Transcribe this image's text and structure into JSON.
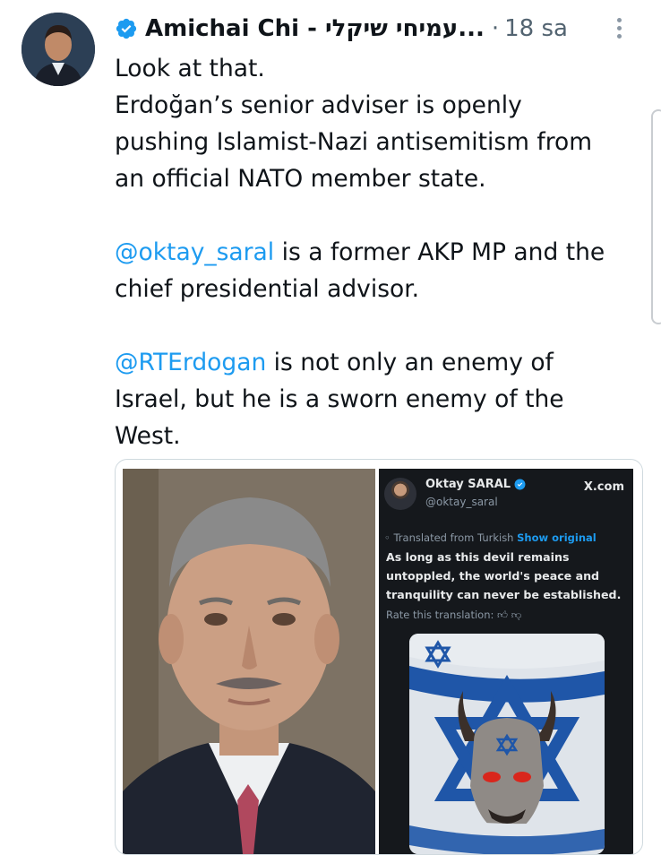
{
  "tweet": {
    "author_name": "Amichai Chi - עמיחי שיקלי...",
    "separator": "·",
    "timestamp": "18 sa",
    "verified_icon": "verified-badge-icon",
    "more_icon": "more-vertical-icon",
    "paragraphs": [
      [
        "Look at that."
      ],
      [
        "Erdoğan’s senior adviser is openly",
        "pushing Islamist-Nazi antisemitism from",
        "an official NATO member state."
      ]
    ],
    "mention1": "@oktay_saral",
    "para2_line1_rest": " is a former AKP MP and the",
    "para2_line2": "chief presidential advisor.",
    "mention2": "@RTErdogan",
    "para3_line1_rest": " is not only an enemy of",
    "para3_line2": "Israel, but he is a sworn enemy of the",
    "para3_line3": "West."
  },
  "embedded": {
    "name": "Oktay SARAL",
    "handle": "@oktay_saral",
    "brand": "X.com",
    "translated_label": "Translated from Turkish",
    "show_original": "Show original",
    "body_lines": [
      "As long as this devil remains",
      "untoppled, the world's peace and",
      "tranquility can never be established."
    ],
    "rate_label": "Rate this translation:",
    "rate_icons": [
      "thumbs-up-icon",
      "thumbs-down-icon"
    ]
  },
  "colors": {
    "link": "#1d9bf0",
    "verified": "#1d9bf0",
    "text": "#0f1419",
    "muted": "#536471"
  }
}
